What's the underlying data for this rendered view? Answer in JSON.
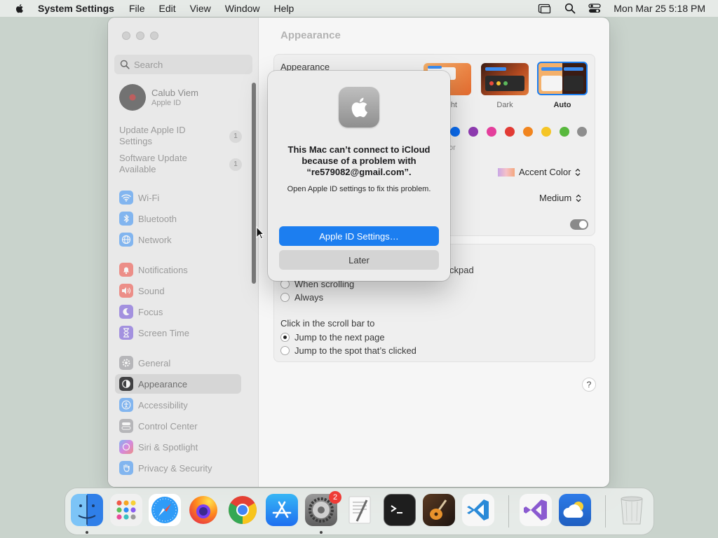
{
  "menubar": {
    "app_name": "System Settings",
    "menus": [
      "File",
      "Edit",
      "View",
      "Window",
      "Help"
    ],
    "clock": "Mon Mar 25  5:18 PM"
  },
  "sidebar": {
    "search_placeholder": "Search",
    "profile": {
      "name": "Calub Viem",
      "subtitle": "Apple ID"
    },
    "notices": [
      {
        "label": "Update Apple ID Settings",
        "line1": "Update Apple ID",
        "line2": "Settings",
        "count": "1"
      },
      {
        "label": "Software Update Available",
        "line1": "Software Update",
        "line2": "Available",
        "count": "1"
      }
    ],
    "items": [
      {
        "label": "Wi-Fi",
        "icon": "wifi-icon",
        "color": "#2f8cf5"
      },
      {
        "label": "Bluetooth",
        "icon": "bluetooth-icon",
        "color": "#2f8cf5"
      },
      {
        "label": "Network",
        "icon": "globe-icon",
        "color": "#2f8cf5"
      },
      {
        "label": "Notifications",
        "icon": "bell-icon",
        "color": "#f0453a"
      },
      {
        "label": "Sound",
        "icon": "speaker-icon",
        "color": "#f0453a"
      },
      {
        "label": "Focus",
        "icon": "moon-icon",
        "color": "#6b4bd8"
      },
      {
        "label": "Screen Time",
        "icon": "hourglass-icon",
        "color": "#6b4bd8"
      },
      {
        "label": "General",
        "icon": "gear-icon",
        "color": "#8e8e93"
      },
      {
        "label": "Appearance",
        "icon": "appearance-icon",
        "color": "#1d1d1f",
        "active": true
      },
      {
        "label": "Accessibility",
        "icon": "accessibility-icon",
        "color": "#2f8cf5"
      },
      {
        "label": "Control Center",
        "icon": "control-center-icon",
        "color": "#8e8e93"
      },
      {
        "label": "Siri & Spotlight",
        "icon": "siri-icon",
        "color": "#c23ad8"
      },
      {
        "label": "Privacy & Security",
        "icon": "hand-icon",
        "color": "#2f8cf5"
      }
    ]
  },
  "content": {
    "title": "Appearance",
    "appearance_label": "Appearance",
    "themes": [
      {
        "label": "Light",
        "visible_label": "ht"
      },
      {
        "label": "Dark",
        "visible_label": "Dark"
      },
      {
        "label": "Auto",
        "visible_label": "Auto",
        "selected": true
      }
    ],
    "accent_colors": [
      "#0a6cf0",
      "#8e3bb0",
      "#e43f9c",
      "#e23b35",
      "#f1851f",
      "#f5c526",
      "#58b83d",
      "#8e8e8e"
    ],
    "accent_caption_fragment": "or",
    "highlight_color_value": "Accent Color",
    "sidebar_icon_size_value": "Medium",
    "scroll_text_fragment": "ckpad",
    "show_scroll_options": [
      "When scrolling",
      "Always"
    ],
    "click_scroll_label": "Click in the scroll bar to",
    "click_scroll_options": [
      "Jump to the next page",
      "Jump to the spot that’s clicked"
    ],
    "click_scroll_selected": 0,
    "help": "?"
  },
  "alert": {
    "title": "This Mac can’t connect to iCloud because of a problem with “re579082@gmail.com”.",
    "body": "Open Apple ID settings to fix this problem.",
    "primary_button": "Apple ID Settings…",
    "secondary_button": "Later"
  },
  "dock": {
    "apps": [
      {
        "name": "Finder",
        "icon": "finder-icon",
        "running": true
      },
      {
        "name": "Launchpad",
        "icon": "launchpad-icon"
      },
      {
        "name": "Safari",
        "icon": "safari-icon"
      },
      {
        "name": "Firefox",
        "icon": "firefox-icon"
      },
      {
        "name": "Chrome",
        "icon": "chrome-icon"
      },
      {
        "name": "App Store",
        "icon": "app-store-icon"
      },
      {
        "name": "System Settings",
        "icon": "system-settings-icon",
        "running": true,
        "badge": "2"
      },
      {
        "name": "TextEdit",
        "icon": "textedit-icon"
      },
      {
        "name": "Terminal",
        "icon": "terminal-icon"
      },
      {
        "name": "GarageBand",
        "icon": "garageband-icon"
      },
      {
        "name": "Visual Studio Code",
        "icon": "vscode-icon"
      },
      {
        "name": "Visual Studio",
        "icon": "visual-studio-icon"
      },
      {
        "name": "Weather",
        "icon": "weather-icon"
      },
      {
        "name": "Trash",
        "icon": "trash-icon"
      }
    ]
  }
}
